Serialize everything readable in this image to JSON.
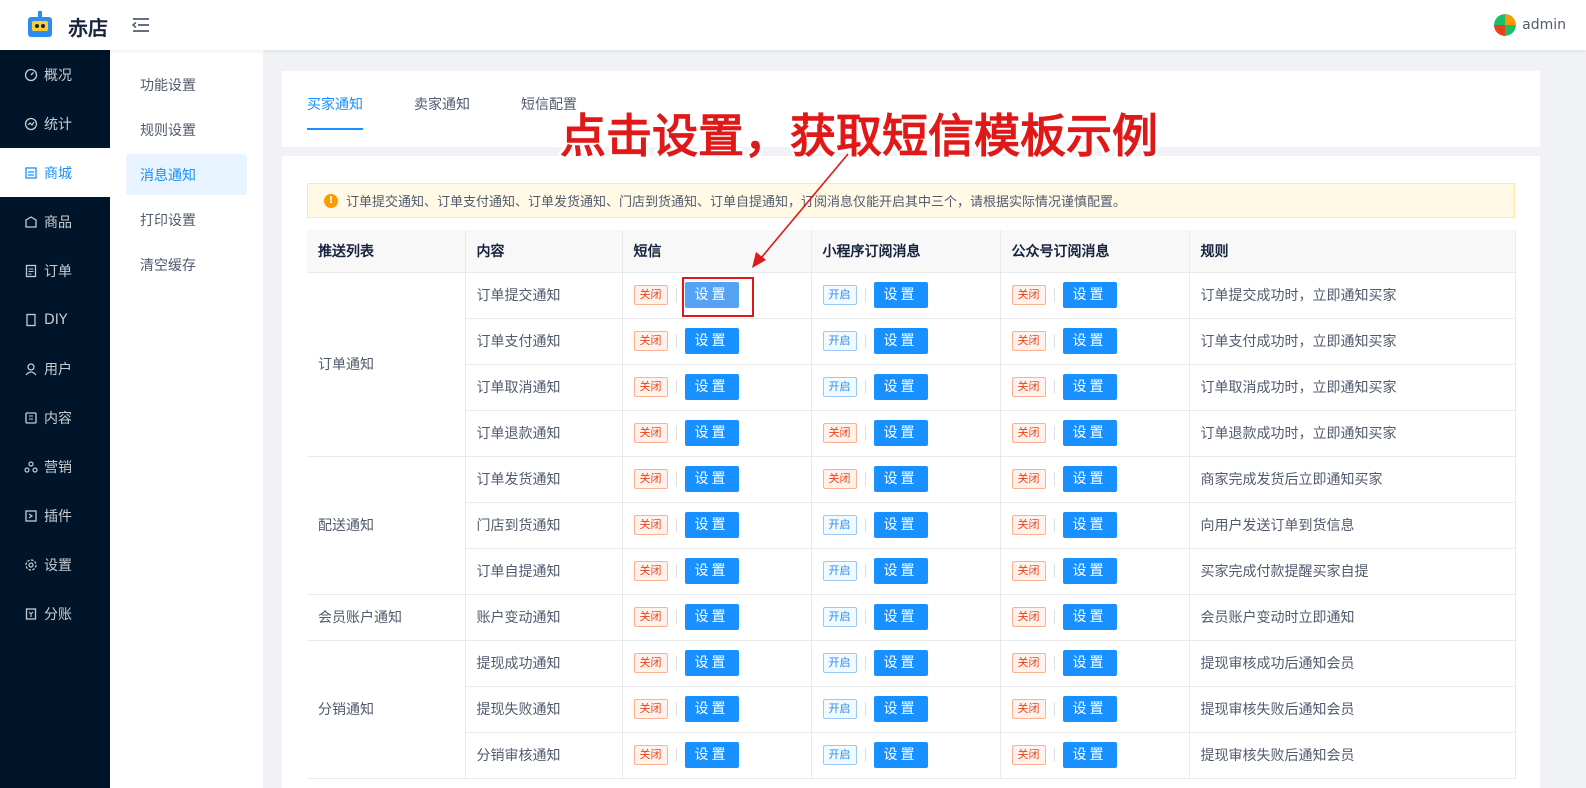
{
  "header": {
    "brand": "赤店",
    "user": "admin"
  },
  "sidebar": {
    "items": [
      {
        "label": "概况",
        "icon": "dashboard-icon"
      },
      {
        "label": "统计",
        "icon": "chart-icon"
      },
      {
        "label": "商城",
        "icon": "store-icon",
        "active": true
      },
      {
        "label": "商品",
        "icon": "goods-icon"
      },
      {
        "label": "订单",
        "icon": "order-icon"
      },
      {
        "label": "DIY",
        "icon": "diy-icon"
      },
      {
        "label": "用户",
        "icon": "user-icon"
      },
      {
        "label": "内容",
        "icon": "content-icon"
      },
      {
        "label": "营销",
        "icon": "marketing-icon"
      },
      {
        "label": "插件",
        "icon": "plugin-icon"
      },
      {
        "label": "设置",
        "icon": "gear-icon"
      },
      {
        "label": "分账",
        "icon": "ledger-icon"
      }
    ]
  },
  "submenu": {
    "items": [
      "功能设置",
      "规则设置",
      "消息通知",
      "打印设置",
      "清空缓存"
    ],
    "active": "消息通知"
  },
  "tabs": [
    "买家通知",
    "卖家通知",
    "短信配置"
  ],
  "alert": "订单提交通知、订单支付通知、订单发货通知、门店到货通知、订单自提通知，订阅消息仅能开启其中三个，请根据实际情况谨慎配置。",
  "table": {
    "headers": [
      "推送列表",
      "内容",
      "短信",
      "小程序订阅消息",
      "公众号订阅消息",
      "规则"
    ],
    "button_label": "设置",
    "groups": [
      "订单通知",
      "配送通知",
      "会员账户通知",
      "分销通知"
    ],
    "rows": [
      {
        "content": "订单提交通知",
        "sms": "关闭",
        "mini": "开启",
        "mp": "关闭",
        "rule": "订单提交成功时，立即通知买家"
      },
      {
        "content": "订单支付通知",
        "sms": "关闭",
        "mini": "开启",
        "mp": "关闭",
        "rule": "订单支付成功时，立即通知买家"
      },
      {
        "content": "订单取消通知",
        "sms": "关闭",
        "mini": "开启",
        "mp": "关闭",
        "rule": "订单取消成功时，立即通知买家"
      },
      {
        "content": "订单退款通知",
        "sms": "关闭",
        "mini": "关闭",
        "mp": "关闭",
        "rule": "订单退款成功时，立即通知买家"
      },
      {
        "content": "订单发货通知",
        "sms": "关闭",
        "mini": "关闭",
        "mp": "关闭",
        "rule": "商家完成发货后立即通知买家"
      },
      {
        "content": "门店到货通知",
        "sms": "关闭",
        "mini": "开启",
        "mp": "关闭",
        "rule": "向用户发送订单到货信息"
      },
      {
        "content": "订单自提通知",
        "sms": "关闭",
        "mini": "开启",
        "mp": "关闭",
        "rule": "买家完成付款提醒买家自提"
      },
      {
        "content": "账户变动通知",
        "sms": "关闭",
        "mini": "开启",
        "mp": "关闭",
        "rule": "会员账户变动时立即通知"
      },
      {
        "content": "提现成功通知",
        "sms": "关闭",
        "mini": "开启",
        "mp": "关闭",
        "rule": "提现审核成功后通知会员"
      },
      {
        "content": "提现失败通知",
        "sms": "关闭",
        "mini": "开启",
        "mp": "关闭",
        "rule": "提现审核失败后通知会员"
      },
      {
        "content": "分销审核通知",
        "sms": "关闭",
        "mini": "开启",
        "mp": "关闭",
        "rule": "提现审核失败后通知会员"
      }
    ]
  },
  "annotation": "点击设置，获取短信模板示例",
  "colors": {
    "primary": "#1890ff",
    "sidebar_bg": "#001529",
    "annotation": "#e01818",
    "danger": "#ed4014"
  }
}
